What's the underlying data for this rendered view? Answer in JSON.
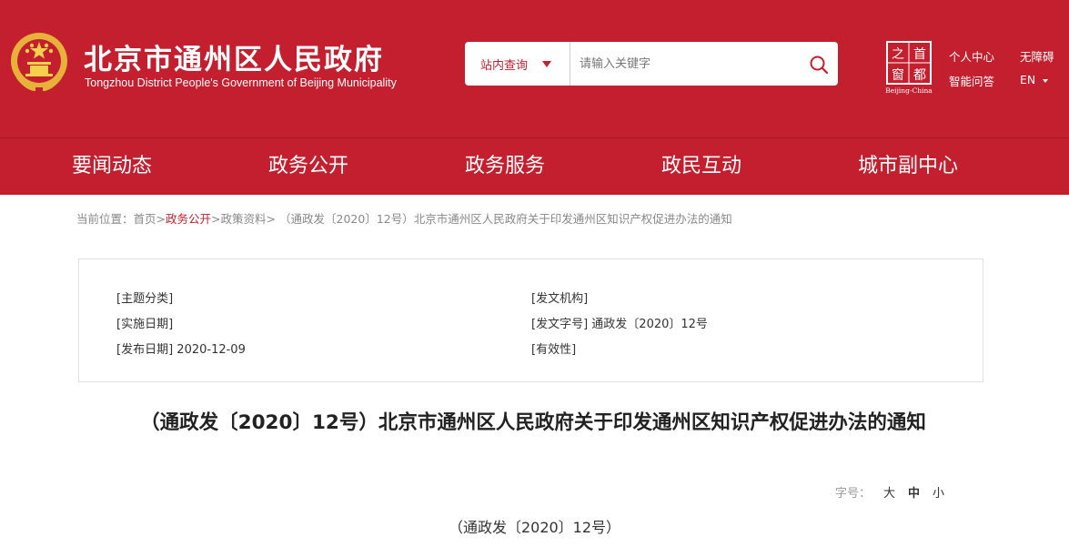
{
  "header": {
    "title": "北京市通州区人民政府",
    "subtitle": "Tongzhou District People's Government of Beijing Municipality",
    "emblem_icon": "national-emblem-icon",
    "capital_logo": {
      "chars": [
        "之",
        "首",
        "窗",
        "都"
      ],
      "caption": "Beijing-China"
    },
    "colors": {
      "brand_red": "#c31f2e",
      "white": "#ffffff"
    }
  },
  "search": {
    "scope_label": "站内查询",
    "placeholder": "请输入关键字",
    "button_icon": "search-icon"
  },
  "top_links": {
    "personal_center": "个人中心",
    "accessibility": "无障碍",
    "smart_qa": "智能问答",
    "language": "EN"
  },
  "nav": {
    "items": [
      {
        "label": "要闻动态"
      },
      {
        "label": "政务公开"
      },
      {
        "label": "政务服务"
      },
      {
        "label": "政民互动"
      },
      {
        "label": "城市副中心"
      }
    ]
  },
  "breadcrumb": {
    "prefix": "当前位置：",
    "home": "首页",
    "sep": ">",
    "section": "政务公开",
    "subsection": "政策资料",
    "current": "（通政发〔2020〕12号）北京市通州区人民政府关于印发通州区知识产权促进办法的通知"
  },
  "info": {
    "subject_category": "[主题分类]",
    "issuing_org": "[发文机构]",
    "effective_date": "[实施日期]",
    "doc_number_label": "[发文字号]",
    "doc_number_value": "通政发〔2020〕12号",
    "publish_date_label": "[发布日期]",
    "publish_date_value": "2020-12-09",
    "validity": "[有效性]"
  },
  "document": {
    "title": "（通政发〔2020〕12号）北京市通州区人民政府关于印发通州区知识产权促进办法的通知",
    "number_line": "（通政发〔2020〕12号）"
  },
  "font_size": {
    "label": "字号：",
    "large": "大",
    "medium": "中",
    "small": "小"
  }
}
